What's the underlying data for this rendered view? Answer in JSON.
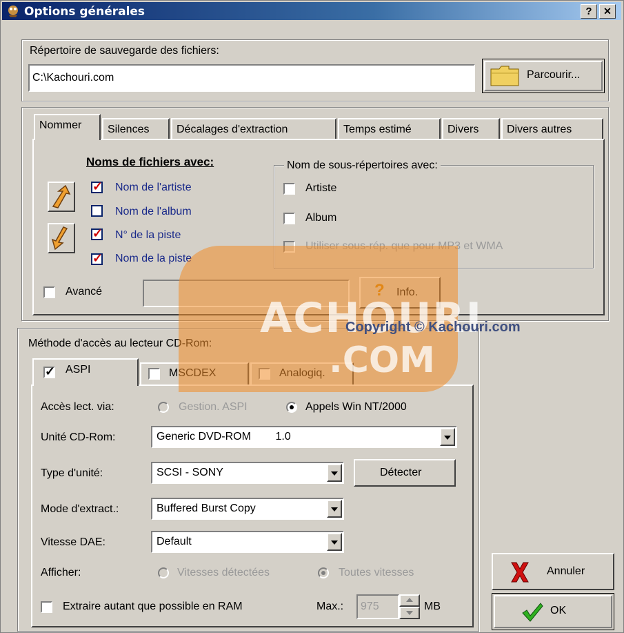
{
  "window": {
    "title": "Options générales",
    "help_glyph": "?",
    "close_glyph": "✕"
  },
  "save_dir": {
    "label": "Répertoire de sauvegarde des fichiers:",
    "value": "C:\\Kachouri.com",
    "browse_label": "Parcourir..."
  },
  "tabs": [
    {
      "label": "Nommer"
    },
    {
      "label": "Silences"
    },
    {
      "label": "Décalages d'extraction"
    },
    {
      "label": "Temps estimé"
    },
    {
      "label": "Divers"
    },
    {
      "label": "Divers autres"
    }
  ],
  "naming": {
    "heading": "Noms de fichiers avec:",
    "items": [
      {
        "label": "Nom de l'artiste",
        "checked": true
      },
      {
        "label": "Nom de l'album",
        "checked": false
      },
      {
        "label": "N° de la piste",
        "checked": true
      },
      {
        "label": "Nom de la piste",
        "checked": true
      }
    ],
    "subdir_legend": "Nom de sous-répertoires avec:",
    "subdir_items": [
      {
        "label": "Artiste"
      },
      {
        "label": "Album"
      },
      {
        "label": "Utiliser sous-rép. que pour MP3 et WMA"
      }
    ],
    "advanced_label": "Avancé",
    "info_label": "Info."
  },
  "cd_access": {
    "legend": "Méthode d'accès au lecteur CD-Rom:",
    "tabs": [
      {
        "label": "ASPI",
        "checked": true
      },
      {
        "label": "MSCDEX",
        "checked": false
      },
      {
        "label": "Analogiq.",
        "checked": false
      }
    ],
    "access_label": "Accès lect. via:",
    "access_opt1": "Gestion. ASPI",
    "access_opt2": "Appels Win NT/2000",
    "unit_label": "Unité CD-Rom:",
    "unit_value": "Generic DVD-ROM        1.0",
    "type_label": "Type d'unité:",
    "type_value": "SCSI - SONY",
    "detect_label": "Détecter",
    "mode_label": "Mode d'extract.:",
    "mode_value": "Buffered Burst Copy",
    "speed_label": "Vitesse DAE:",
    "speed_value": "Default",
    "display_label": "Afficher:",
    "display_opt1": "Vitesses détectées",
    "display_opt2": "Toutes vitesses",
    "ram_label": "Extraire autant que possible en RAM",
    "max_label": "Max.:",
    "max_value": "975",
    "unit_mb": "MB"
  },
  "buttons": {
    "cancel": "Annuler",
    "ok": "OK"
  },
  "watermark": {
    "line1": "ACHOURI",
    "line2": ".COM",
    "copyright": "Copyright © Kachouri.com"
  }
}
